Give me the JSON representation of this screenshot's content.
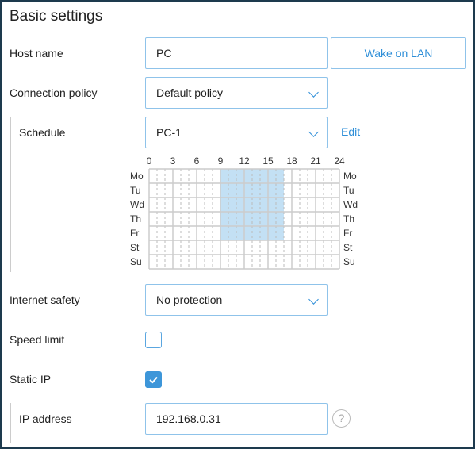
{
  "title": "Basic settings",
  "host": {
    "label": "Host name",
    "value": "PC",
    "wake_label": "Wake on LAN"
  },
  "policy": {
    "label": "Connection policy",
    "value": "Default policy"
  },
  "schedule": {
    "label": "Schedule",
    "value": "PC-1",
    "edit_label": "Edit",
    "hours": [
      "0",
      "3",
      "6",
      "9",
      "12",
      "15",
      "18",
      "21",
      "24"
    ],
    "days": [
      "Mo",
      "Tu",
      "Wd",
      "Th",
      "Fr",
      "St",
      "Su"
    ],
    "active": {
      "days": [
        "Mo",
        "Tu",
        "Wd",
        "Th",
        "Fr"
      ],
      "from_hour": 9,
      "to_hour": 17
    },
    "active_color": "#c3e0f4"
  },
  "safety": {
    "label": "Internet safety",
    "value": "No protection"
  },
  "speed": {
    "label": "Speed limit",
    "checked": false
  },
  "static_ip": {
    "label": "Static IP",
    "checked": true
  },
  "ip": {
    "label": "IP address",
    "value": "192.168.0.31",
    "help": "?"
  }
}
